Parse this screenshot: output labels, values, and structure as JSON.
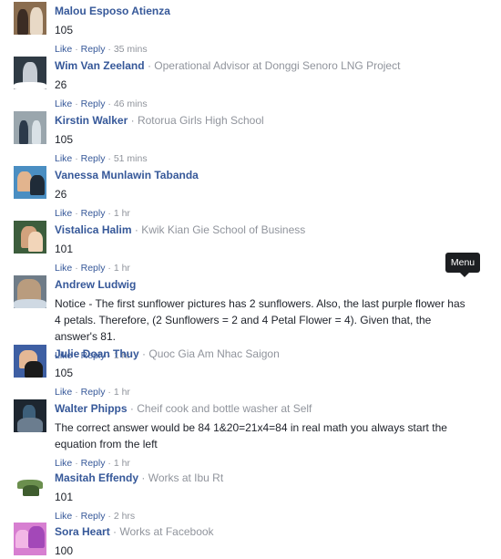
{
  "ui": {
    "like": "Like",
    "reply": "Reply",
    "dot": "·",
    "menu_tooltip": "Menu"
  },
  "comments": [
    {
      "name": "Malou Esposo Atienza",
      "work": "",
      "text": "105",
      "time": "35 mins"
    },
    {
      "name": "Wim Van Zeeland",
      "work": "Operational Advisor at Donggi Senoro LNG Project",
      "text": "26",
      "time": "46 mins"
    },
    {
      "name": "Kirstin Walker",
      "work": "Rotorua Girls High School",
      "text": "105",
      "time": "51 mins"
    },
    {
      "name": "Vanessa Munlawin Tabanda",
      "work": "",
      "text": "26",
      "time": "1 hr"
    },
    {
      "name": "Vistalica Halim",
      "work": "Kwik Kian Gie School of Business",
      "text": "101",
      "time": "1 hr"
    },
    {
      "name": "Andrew Ludwig",
      "work": "",
      "text": "Notice - The first sunflower pictures has 2 sunflowers. Also, the last purple flower has 4 petals. Therefore, (2 Sunflowers = 2 and 4 Petal Flower = 4). Given that, the answer's 81.",
      "time": "1 hr"
    },
    {
      "name": "Julie Doan Thuy",
      "work": "Quoc Gia Am Nhac Saigon",
      "text": "105",
      "time": "1 hr"
    },
    {
      "name": "Walter Phipps",
      "work": "Cheif cook and bottle washer at Self",
      "text": "The correct answer would be 84 1&20=21x4=84 in real math you always start the equation from the left",
      "time": "1 hr"
    },
    {
      "name": "Masitah Effendy",
      "work": "Works at Ibu Rt",
      "text": "101",
      "time": "2 hrs"
    },
    {
      "name": "Sora Heart",
      "work": "Works at Facebook",
      "text": "100",
      "time": ""
    }
  ],
  "avatar_colors": [
    [
      "#8a6d4f",
      "#3b2c24",
      "#e8d9c6"
    ],
    [
      "#2f3a44",
      "#c7cdd4",
      "#ffffff"
    ],
    [
      "#9aa6ad",
      "#2c3a4a",
      "#d9e1e6"
    ],
    [
      "#4a8ec2",
      "#e2b48e",
      "#1f2b38"
    ],
    [
      "#3c5d3c",
      "#d2a27d",
      "#f2d5b9"
    ],
    [
      "#6f7c88",
      "#b99c7e",
      "#cfd9e3"
    ],
    [
      "#3e5fa3",
      "#e5b895",
      "#1b1b1b"
    ],
    [
      "#1d2630",
      "#3d5f7a",
      "#6b7d8f"
    ],
    [
      "#ffffff",
      "#6b8f4e",
      "#3f5d2e"
    ],
    [
      "#d77fd1",
      "#f2b7e6",
      "#a348b8"
    ]
  ]
}
